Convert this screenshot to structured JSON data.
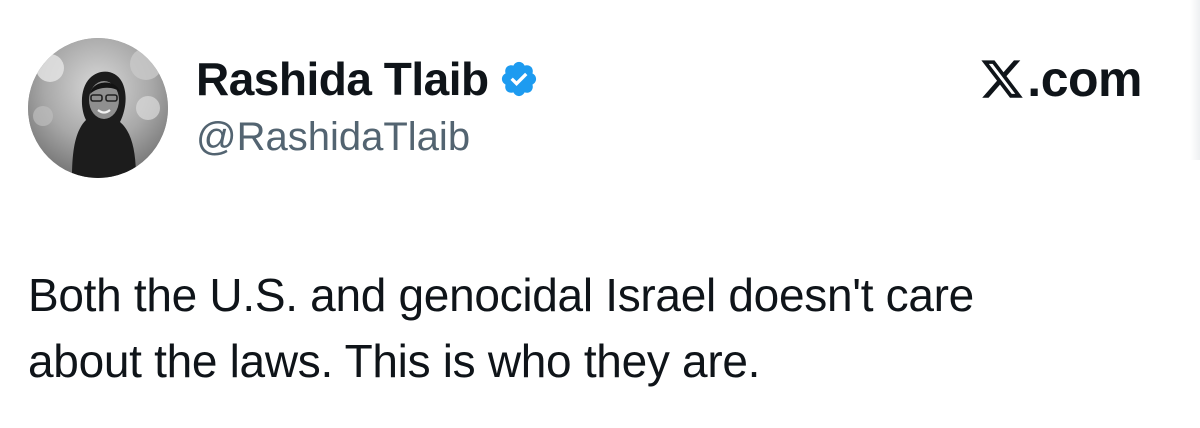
{
  "author": {
    "display_name": "Rashida Tlaib",
    "handle": "@RashidaTlaib",
    "verified": true,
    "avatar_icon": "profile-photo",
    "verified_icon": "verified-badge-icon"
  },
  "brand": {
    "logo_icon": "x-logo-icon",
    "text": ".com"
  },
  "tweet": {
    "lines": [
      "Both the U.S. and genocidal Israel doesn't care",
      "about the laws. This is who they are."
    ]
  },
  "colors": {
    "text_primary": "#0f1419",
    "text_secondary": "#536471",
    "verified_blue": "#1d9bf0",
    "background": "#ffffff"
  }
}
